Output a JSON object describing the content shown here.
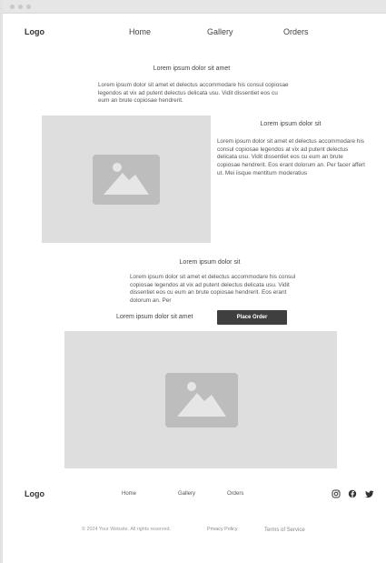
{
  "header": {
    "logo": "Logo",
    "nav": [
      "Home",
      "Gallery",
      "Orders"
    ]
  },
  "intro": {
    "heading": "Lorem ipsum dolor sit amet",
    "text": "Lorem ipsum dolor sit amet et delectus accommodare his consul copiosae legendos at vix ad putent delectus delicata usu. Vidit dissentiet eos cu eum an brute copiosae hendrerit."
  },
  "feature": {
    "heading": "Lorem ipsum dolor sit",
    "text": "Lorem ipsum dolor sit amet et delectus accommodare his consul copiosae legendos at vix ad putent delectus delicata usu. Vidit dissentiet eos cu eum an brute copiosae hendrerit. Eos erant dolorum an. Per facer affert ut. Mei iisque mentitum moderatius"
  },
  "order": {
    "heading": "Lorem ipsum dolor sit",
    "text": "Lorem ipsum dolor sit amet et delectus accommodare his consul copiosae legendos at vix ad putent delectus delicata usu. Vidit dissentiet eos cu eum an brute copiosae hendrerit. Eos erant dolorum an. Per",
    "cta_label": "Lorem ipsum dolor sit amet",
    "button": "Place Order"
  },
  "footer": {
    "logo": "Logo",
    "nav": [
      "Home",
      "Gallery",
      "Orders"
    ],
    "copyright": "© 2024 Your Website. All rights reserved.",
    "privacy": "Privacy Policy",
    "terms": "Terms of Service",
    "social_icons": [
      "instagram-icon",
      "facebook-icon",
      "twitter-icon"
    ]
  }
}
